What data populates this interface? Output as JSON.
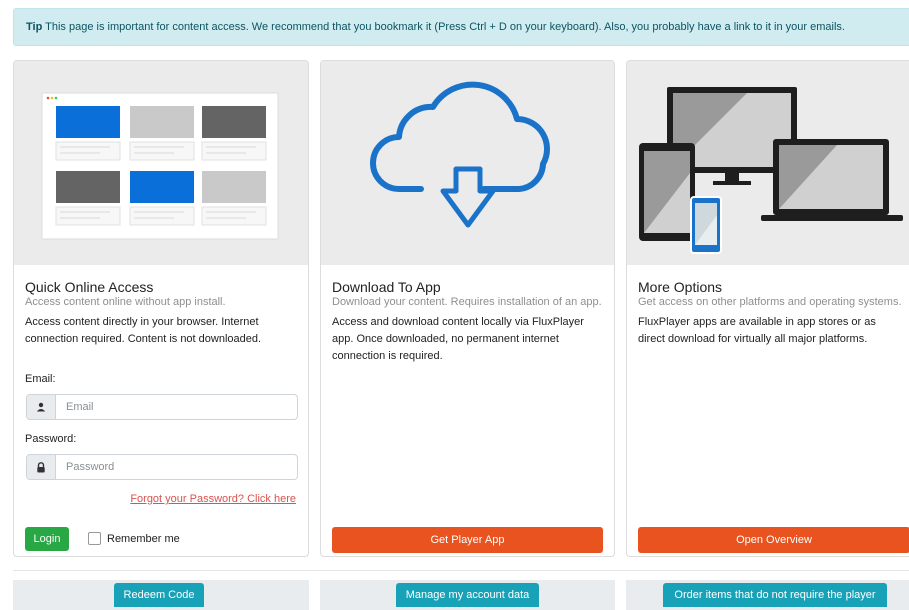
{
  "tip": {
    "label": "Tip",
    "text": "This page is important for content access. We recommend that you bookmark it (Press Ctrl + D on your keyboard). Also, you probably have a link to it in your emails."
  },
  "cards": [
    {
      "title": "Quick Online Access",
      "subtitle": "Access content online without app install.",
      "text": "Access content directly in your browser. Internet connection required. Content is not downloaded.",
      "image_icon": "browser-grid-illustration"
    },
    {
      "title": "Download To App",
      "subtitle": "Download your content. Requires installation of an app.",
      "text": "Access and download content locally via FluxPlayer app. Once downloaded, no permanent internet connection is required.",
      "image_icon": "cloud-download-icon",
      "button": "Get Player App"
    },
    {
      "title": "More Options",
      "subtitle": "Get access on other platforms and operating systems.",
      "text": "FluxPlayer apps are available in app stores or as direct download for virtually all major platforms.",
      "image_icon": "devices-illustration",
      "button": "Open Overview"
    }
  ],
  "login": {
    "email_label": "Email:",
    "email_placeholder": "Email",
    "password_label": "Password:",
    "password_placeholder": "Password",
    "forgot": "Forgot your Password? Click here",
    "login_button": "Login",
    "remember": "Remember me"
  },
  "bottom_buttons": [
    "Redeem Code",
    "Manage my account data",
    "Order items that do not require the player"
  ],
  "colors": {
    "tip_bg": "#d1ecf1",
    "login_green": "#28a745",
    "action_orange": "#e8531f",
    "teal": "#17a2b8",
    "forgot_red": "#d9534f",
    "cloud_blue": "#1a73c9"
  }
}
